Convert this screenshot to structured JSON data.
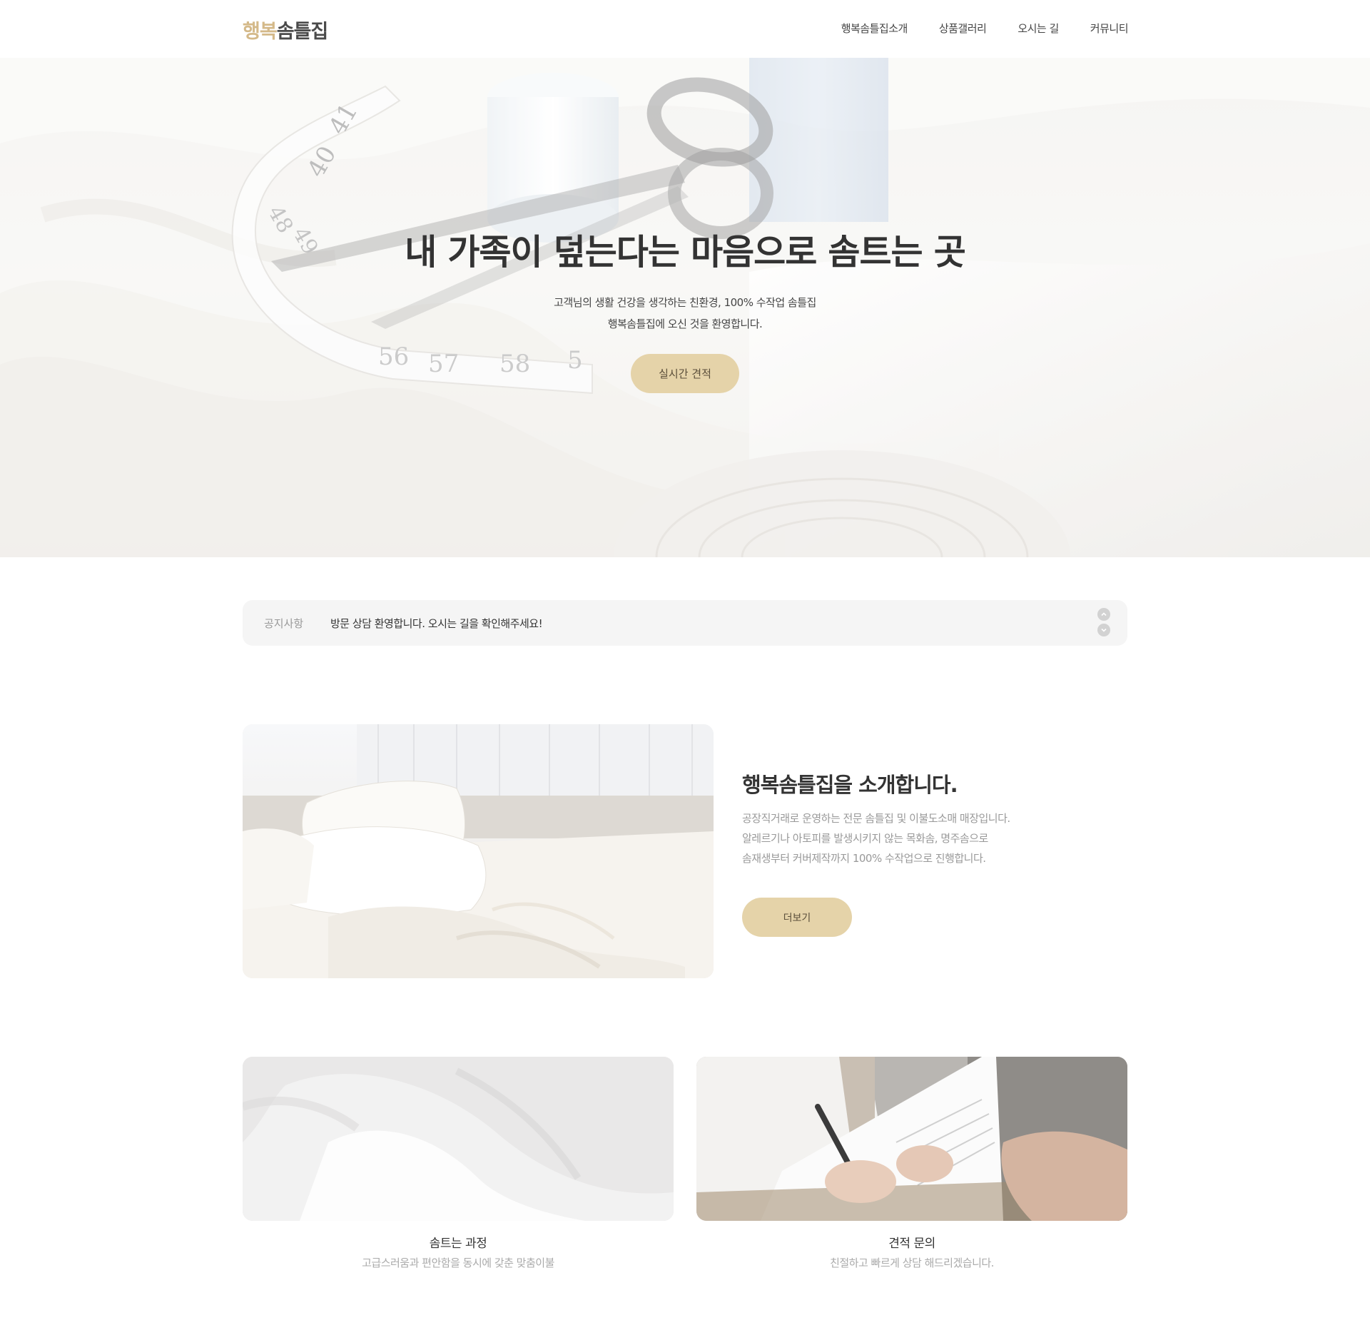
{
  "header": {
    "logo_part1": "행복",
    "logo_part2": "솜틀집",
    "nav": [
      "행복솜틀집소개",
      "상품갤러리",
      "오시는 길",
      "커뮤니티"
    ]
  },
  "hero": {
    "title": "내 가족이 덮는다는 마음으로 솜트는 곳",
    "subtitle_line1": "고객님의 생활 건강을 생각하는 친환경, 100% 수작업 솜틀집",
    "subtitle_line2": "행복솜틀집에 오신 것을 환영합니다.",
    "button_label": "실시간 견적",
    "tape_numbers": [
      "41",
      "40",
      "48",
      "49",
      "56",
      "57",
      "58",
      "5"
    ]
  },
  "notice": {
    "label": "공지사항",
    "text": "방문 상담 환영합니다. 오시는 길을 확인해주세요!"
  },
  "intro": {
    "title": "행복솜틀집을 소개합니다.",
    "desc_line1": "공장직거래로 운영하는 전문 솜틀집 및 이불도소매 매장입니다.",
    "desc_line2": "알레르기나 아토피를 발생시키지 않는 목화솜, 명주솜으로",
    "desc_line3": "솜재생부터 커버제작까지 100% 수작업으로 진행합니다.",
    "button_label": "더보기"
  },
  "cards": [
    {
      "title": "솜트는 과정",
      "subtitle": "고급스러움과 편안함을 동시에 갖춘 맞춤이불"
    },
    {
      "title": "견적 문의",
      "subtitle": "친절하고 빠르게 상담 해드리겠습니다."
    }
  ],
  "colors": {
    "accent": "#e5d3a9",
    "logo_accent": "#d4b989",
    "text_dark": "#333333",
    "text_muted": "#999999",
    "notice_bg": "#f5f5f5"
  }
}
